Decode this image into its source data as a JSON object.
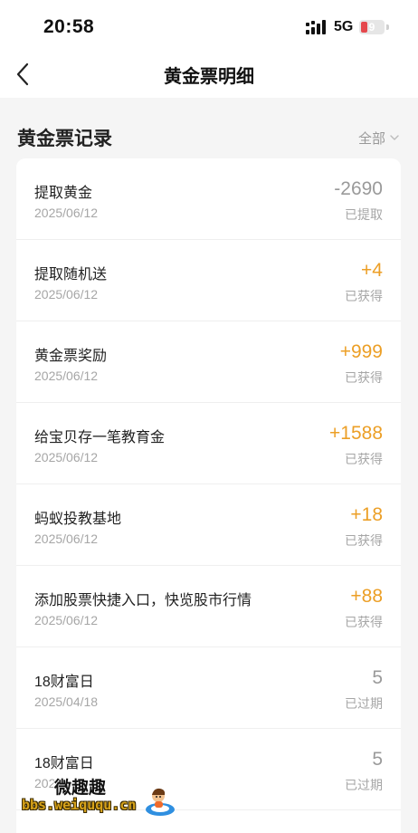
{
  "status_bar": {
    "time": "20:58",
    "network": "5G",
    "battery_level": "9",
    "battery_color": "#e5484d"
  },
  "nav": {
    "title": "黄金票明细",
    "back_icon": "chevron-left-icon"
  },
  "section": {
    "title": "黄金票记录",
    "filter_label": "全部",
    "filter_icon": "chevron-down-icon"
  },
  "colors": {
    "positive_amount": "#ec9f26",
    "neutral_amount": "#9a9a9a"
  },
  "records": [
    {
      "title": "提取黄金",
      "date": "2025/06/12",
      "amount": "-2690",
      "status": "已提取"
    },
    {
      "title": "提取随机送",
      "date": "2025/06/12",
      "amount": "+4",
      "status": "已获得"
    },
    {
      "title": "黄金票奖励",
      "date": "2025/06/12",
      "amount": "+999",
      "status": "已获得"
    },
    {
      "title": "给宝贝存一笔教育金",
      "date": "2025/06/12",
      "amount": "+1588",
      "status": "已获得"
    },
    {
      "title": "蚂蚁投教基地",
      "date": "2025/06/12",
      "amount": "+18",
      "status": "已获得"
    },
    {
      "title": "添加股票快捷入口，快览股市行情",
      "date": "2025/06/12",
      "amount": "+88",
      "status": "已获得"
    },
    {
      "title": "18财富日",
      "date": "2025/04/18",
      "amount": "5",
      "status": "已过期"
    },
    {
      "title": "18财富日",
      "date": "202",
      "amount": "5",
      "status": "已过期"
    }
  ],
  "watermark": {
    "name": "微趣趣",
    "url": "bbs.weiququ.cn"
  }
}
